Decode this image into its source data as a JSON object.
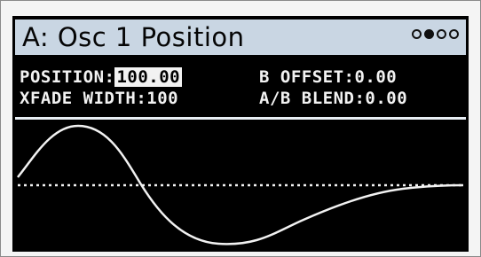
{
  "header": {
    "title": "A: Osc 1 Position",
    "page_indicator": {
      "total": 4,
      "active_index": 1
    }
  },
  "params": {
    "position_label": "POSITION:",
    "position_value": "100.00",
    "b_offset_label": "B OFFSET:",
    "b_offset_value": "0.00",
    "xfade_width_label": "XFADE WIDTH:",
    "xfade_width_value": "100",
    "ab_blend_label": "A/B BLEND:",
    "ab_blend_value": "0.00"
  },
  "colors": {
    "screen_bg": "#000000",
    "title_bg": "#c9d6e3",
    "text": "#f2f2f2",
    "waveform": "#f2f2f2"
  }
}
